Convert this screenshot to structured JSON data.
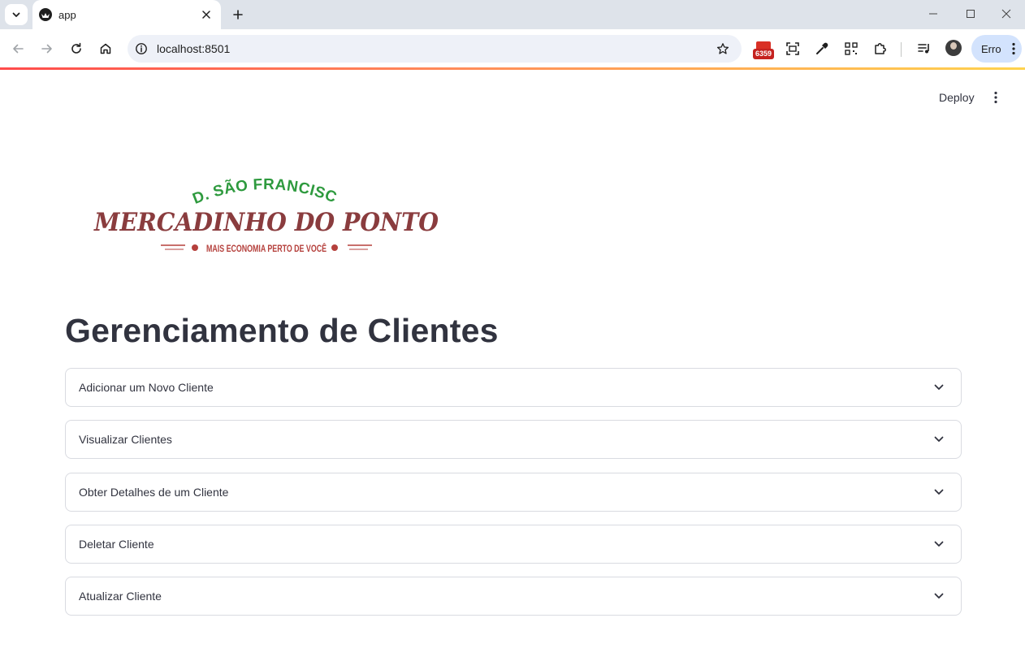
{
  "browser": {
    "tab_title": "app",
    "url": "localhost:8501",
    "extension_badge_count": "6359",
    "profile_button_label": "Erro"
  },
  "app": {
    "deploy_label": "Deploy",
    "logo": {
      "top_text": ".JD. SÃO FRANCISCO.",
      "main_text": "MERCADINHO DO PONTO",
      "tagline": "MAIS ECONOMIA PERTO DE VOCÊ",
      "colors": {
        "green": "#2e9a3e",
        "main": "#8a3c3e",
        "tagline": "#b5403c"
      }
    },
    "title": "Gerenciamento de Clientes",
    "expanders": [
      {
        "label": "Adicionar um Novo Cliente"
      },
      {
        "label": "Visualizar Clientes"
      },
      {
        "label": "Obter Detalhes de um Cliente"
      },
      {
        "label": "Deletar Cliente"
      },
      {
        "label": "Atualizar Cliente"
      }
    ]
  },
  "colors": {
    "text": "#31333f",
    "border": "#d9dbe1",
    "tabstrip": "#dee3ea",
    "omnibox": "#eef1f8",
    "profile_pill": "#d3e3fd"
  }
}
